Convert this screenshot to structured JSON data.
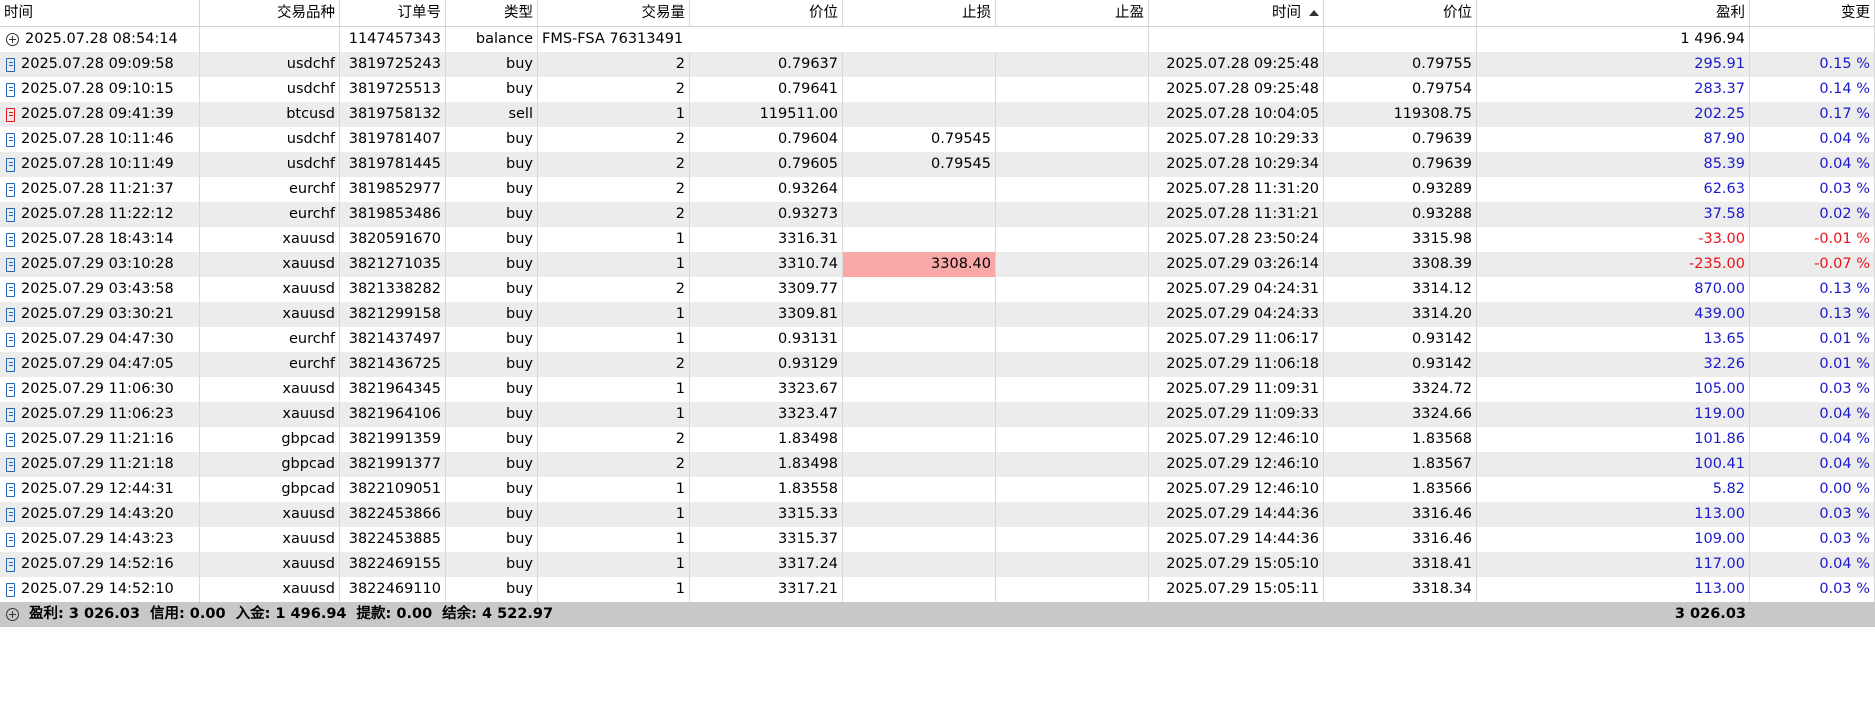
{
  "headers": [
    "时间",
    "交易品种",
    "订单号",
    "类型",
    "交易量",
    "价位",
    "止损",
    "止盈",
    "时间",
    "价位",
    "盈利",
    "变更"
  ],
  "balance_row": {
    "time": "2025.07.28 08:54:14",
    "order": "1147457343",
    "type": "balance",
    "comment": "FMS-FSA 76313491",
    "profit": "1 496.94"
  },
  "trades": [
    {
      "icon": "buy",
      "time": "2025.07.28 09:09:58",
      "symbol": "usdchf",
      "order": "3819725243",
      "type": "buy",
      "volume": "2",
      "price": "0.79637",
      "sl": "",
      "tp": "",
      "close_time": "2025.07.28 09:25:48",
      "close_price": "0.79755",
      "profit": "295.91",
      "change": "0.15 %"
    },
    {
      "icon": "buy",
      "time": "2025.07.28 09:10:15",
      "symbol": "usdchf",
      "order": "3819725513",
      "type": "buy",
      "volume": "2",
      "price": "0.79641",
      "sl": "",
      "tp": "",
      "close_time": "2025.07.28 09:25:48",
      "close_price": "0.79754",
      "profit": "283.37",
      "change": "0.14 %"
    },
    {
      "icon": "sell",
      "time": "2025.07.28 09:41:39",
      "symbol": "btcusd",
      "order": "3819758132",
      "type": "sell",
      "volume": "1",
      "price": "119511.00",
      "sl": "",
      "tp": "",
      "close_time": "2025.07.28 10:04:05",
      "close_price": "119308.75",
      "profit": "202.25",
      "change": "0.17 %"
    },
    {
      "icon": "buy",
      "time": "2025.07.28 10:11:46",
      "symbol": "usdchf",
      "order": "3819781407",
      "type": "buy",
      "volume": "2",
      "price": "0.79604",
      "sl": "0.79545",
      "tp": "",
      "close_time": "2025.07.28 10:29:33",
      "close_price": "0.79639",
      "profit": "87.90",
      "change": "0.04 %"
    },
    {
      "icon": "buy",
      "time": "2025.07.28 10:11:49",
      "symbol": "usdchf",
      "order": "3819781445",
      "type": "buy",
      "volume": "2",
      "price": "0.79605",
      "sl": "0.79545",
      "tp": "",
      "close_time": "2025.07.28 10:29:34",
      "close_price": "0.79639",
      "profit": "85.39",
      "change": "0.04 %"
    },
    {
      "icon": "buy",
      "time": "2025.07.28 11:21:37",
      "symbol": "eurchf",
      "order": "3819852977",
      "type": "buy",
      "volume": "2",
      "price": "0.93264",
      "sl": "",
      "tp": "",
      "close_time": "2025.07.28 11:31:20",
      "close_price": "0.93289",
      "profit": "62.63",
      "change": "0.03 %"
    },
    {
      "icon": "buy",
      "time": "2025.07.28 11:22:12",
      "symbol": "eurchf",
      "order": "3819853486",
      "type": "buy",
      "volume": "2",
      "price": "0.93273",
      "sl": "",
      "tp": "",
      "close_time": "2025.07.28 11:31:21",
      "close_price": "0.93288",
      "profit": "37.58",
      "change": "0.02 %"
    },
    {
      "icon": "buy",
      "time": "2025.07.28 18:43:14",
      "symbol": "xauusd",
      "order": "3820591670",
      "type": "buy",
      "volume": "1",
      "price": "3316.31",
      "sl": "",
      "tp": "",
      "close_time": "2025.07.28 23:50:24",
      "close_price": "3315.98",
      "profit": "-33.00",
      "change": "-0.01 %"
    },
    {
      "icon": "buy",
      "time": "2025.07.29 03:10:28",
      "symbol": "xauusd",
      "order": "3821271035",
      "type": "buy",
      "volume": "1",
      "price": "3310.74",
      "sl": "3308.40",
      "sl_hit": true,
      "tp": "",
      "close_time": "2025.07.29 03:26:14",
      "close_price": "3308.39",
      "profit": "-235.00",
      "change": "-0.07 %"
    },
    {
      "icon": "buy",
      "time": "2025.07.29 03:43:58",
      "symbol": "xauusd",
      "order": "3821338282",
      "type": "buy",
      "volume": "2",
      "price": "3309.77",
      "sl": "",
      "tp": "",
      "close_time": "2025.07.29 04:24:31",
      "close_price": "3314.12",
      "profit": "870.00",
      "change": "0.13 %"
    },
    {
      "icon": "buy",
      "time": "2025.07.29 03:30:21",
      "symbol": "xauusd",
      "order": "3821299158",
      "type": "buy",
      "volume": "1",
      "price": "3309.81",
      "sl": "",
      "tp": "",
      "close_time": "2025.07.29 04:24:33",
      "close_price": "3314.20",
      "profit": "439.00",
      "change": "0.13 %"
    },
    {
      "icon": "buy",
      "time": "2025.07.29 04:47:30",
      "symbol": "eurchf",
      "order": "3821437497",
      "type": "buy",
      "volume": "1",
      "price": "0.93131",
      "sl": "",
      "tp": "",
      "close_time": "2025.07.29 11:06:17",
      "close_price": "0.93142",
      "profit": "13.65",
      "change": "0.01 %"
    },
    {
      "icon": "buy",
      "time": "2025.07.29 04:47:05",
      "symbol": "eurchf",
      "order": "3821436725",
      "type": "buy",
      "volume": "2",
      "price": "0.93129",
      "sl": "",
      "tp": "",
      "close_time": "2025.07.29 11:06:18",
      "close_price": "0.93142",
      "profit": "32.26",
      "change": "0.01 %"
    },
    {
      "icon": "buy",
      "time": "2025.07.29 11:06:30",
      "symbol": "xauusd",
      "order": "3821964345",
      "type": "buy",
      "volume": "1",
      "price": "3323.67",
      "sl": "",
      "tp": "",
      "close_time": "2025.07.29 11:09:31",
      "close_price": "3324.72",
      "profit": "105.00",
      "change": "0.03 %"
    },
    {
      "icon": "buy",
      "time": "2025.07.29 11:06:23",
      "symbol": "xauusd",
      "order": "3821964106",
      "type": "buy",
      "volume": "1",
      "price": "3323.47",
      "sl": "",
      "tp": "",
      "close_time": "2025.07.29 11:09:33",
      "close_price": "3324.66",
      "profit": "119.00",
      "change": "0.04 %"
    },
    {
      "icon": "buy",
      "time": "2025.07.29 11:21:16",
      "symbol": "gbpcad",
      "order": "3821991359",
      "type": "buy",
      "volume": "2",
      "price": "1.83498",
      "sl": "",
      "tp": "",
      "close_time": "2025.07.29 12:46:10",
      "close_price": "1.83568",
      "profit": "101.86",
      "change": "0.04 %"
    },
    {
      "icon": "buy",
      "time": "2025.07.29 11:21:18",
      "symbol": "gbpcad",
      "order": "3821991377",
      "type": "buy",
      "volume": "2",
      "price": "1.83498",
      "sl": "",
      "tp": "",
      "close_time": "2025.07.29 12:46:10",
      "close_price": "1.83567",
      "profit": "100.41",
      "change": "0.04 %"
    },
    {
      "icon": "buy",
      "time": "2025.07.29 12:44:31",
      "symbol": "gbpcad",
      "order": "3822109051",
      "type": "buy",
      "volume": "1",
      "price": "1.83558",
      "sl": "",
      "tp": "",
      "close_time": "2025.07.29 12:46:10",
      "close_price": "1.83566",
      "profit": "5.82",
      "change": "0.00 %"
    },
    {
      "icon": "buy",
      "time": "2025.07.29 14:43:20",
      "symbol": "xauusd",
      "order": "3822453866",
      "type": "buy",
      "volume": "1",
      "price": "3315.33",
      "sl": "",
      "tp": "",
      "close_time": "2025.07.29 14:44:36",
      "close_price": "3316.46",
      "profit": "113.00",
      "change": "0.03 %"
    },
    {
      "icon": "buy",
      "time": "2025.07.29 14:43:23",
      "symbol": "xauusd",
      "order": "3822453885",
      "type": "buy",
      "volume": "1",
      "price": "3315.37",
      "sl": "",
      "tp": "",
      "close_time": "2025.07.29 14:44:36",
      "close_price": "3316.46",
      "profit": "109.00",
      "change": "0.03 %"
    },
    {
      "icon": "buy",
      "time": "2025.07.29 14:52:16",
      "symbol": "xauusd",
      "order": "3822469155",
      "type": "buy",
      "volume": "1",
      "price": "3317.24",
      "sl": "",
      "tp": "",
      "close_time": "2025.07.29 15:05:10",
      "close_price": "3318.41",
      "profit": "117.00",
      "change": "0.04 %"
    },
    {
      "icon": "buy",
      "time": "2025.07.29 14:52:10",
      "symbol": "xauusd",
      "order": "3822469110",
      "type": "buy",
      "volume": "1",
      "price": "3317.21",
      "sl": "",
      "tp": "",
      "close_time": "2025.07.29 15:05:11",
      "close_price": "3318.34",
      "profit": "113.00",
      "change": "0.03 %"
    }
  ],
  "summary": {
    "profit": "盈利: 3 026.03",
    "credit": "信用: 0.00",
    "deposit": "入金: 1 496.94",
    "withdrawal": "提款: 0.00",
    "balance": "结余: 4 522.97",
    "total_profit": "3 026.03"
  },
  "colors": {
    "profit_positive": "#1a1acc",
    "profit_negative": "#e8121a",
    "sl_highlight": "#f9a8a8",
    "row_alt": "#ececec",
    "footer_bg": "#c8c8c8"
  }
}
